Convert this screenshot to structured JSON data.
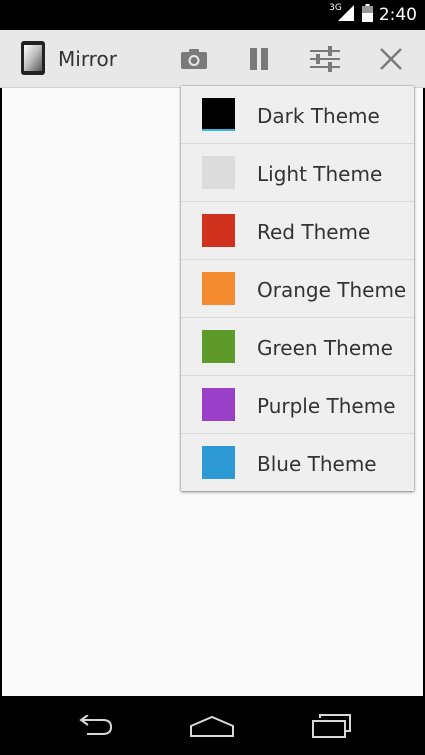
{
  "status_bar": {
    "network_type": "3G",
    "clock": "2:40",
    "icons": [
      "signal-icon",
      "battery-icon"
    ]
  },
  "action_bar": {
    "title": "Mirror",
    "icons": [
      "phone-mirror-app-icon",
      "camera-icon",
      "pause-icon",
      "sliders-icon",
      "close-icon"
    ]
  },
  "theme_menu": {
    "items": [
      {
        "label": "Dark Theme",
        "color": "#000000"
      },
      {
        "label": "Light Theme",
        "color": "#dcdcdc"
      },
      {
        "label": "Red Theme",
        "color": "#d0321d"
      },
      {
        "label": "Orange Theme",
        "color": "#f48a2e"
      },
      {
        "label": "Green Theme",
        "color": "#5e9a2a"
      },
      {
        "label": "Purple Theme",
        "color": "#9a3fc8"
      },
      {
        "label": "Blue Theme",
        "color": "#2d9ad6"
      }
    ]
  },
  "nav_bar": {
    "icons": [
      "back-icon",
      "home-icon",
      "recents-icon"
    ]
  }
}
